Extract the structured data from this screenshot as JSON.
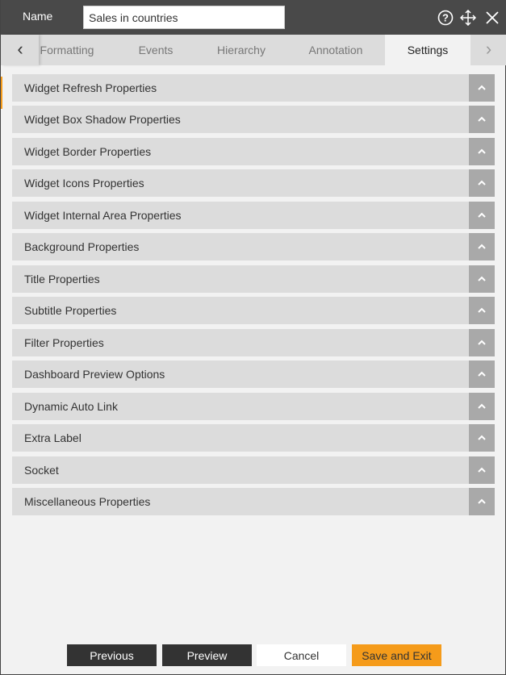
{
  "header": {
    "name_label": "Name",
    "name_value": "Sales in countries",
    "icons": [
      "help-icon",
      "move-icon",
      "close-icon"
    ]
  },
  "tabs": [
    {
      "label": "Formatting"
    },
    {
      "label": "Events"
    },
    {
      "label": "Hierarchy"
    },
    {
      "label": "Annotation"
    },
    {
      "label": "Settings",
      "active": true
    }
  ],
  "sections": [
    "Widget Refresh Properties",
    "Widget Box Shadow Properties",
    "Widget Border Properties",
    "Widget Icons Properties",
    "Widget Internal Area Properties",
    "Background Properties",
    "Title Properties",
    "Subtitle Properties",
    "Filter Properties",
    "Dashboard Preview Options",
    "Dynamic Auto Link",
    "Extra Label",
    "Socket",
    "Miscellaneous Properties"
  ],
  "footer": {
    "previous": "Previous",
    "preview": "Preview",
    "cancel": "Cancel",
    "save": "Save and Exit"
  },
  "colors": {
    "header": "#494949",
    "accent": "#f59b1a",
    "dark_button": "#333333"
  }
}
